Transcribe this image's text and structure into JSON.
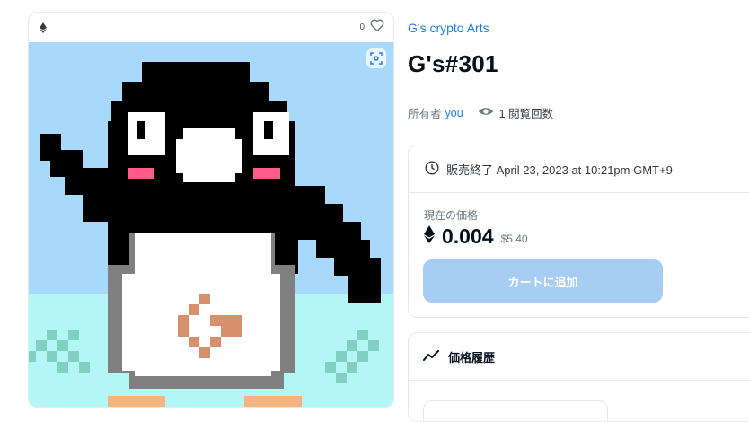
{
  "item": {
    "collection": "G's crypto Arts",
    "title": "G's#301",
    "owner_label": "所有者",
    "owner_name": "you",
    "views_text": "1 閲覧回数",
    "favorites_count": "0"
  },
  "sale": {
    "end_text": "販売終了 April 23, 2023 at 10:21pm GMT+9",
    "price_label": "現在の価格",
    "price_eth": "0.004",
    "price_usd": "$5.40",
    "cart_button": "カートに追加"
  },
  "history": {
    "title": "価格履歴"
  },
  "icons": {
    "chain": "ethereum-icon",
    "favorite": "heart-icon",
    "views": "eye-icon",
    "clock": "clock-icon",
    "history": "trend-icon",
    "zoom": "scan-icon"
  },
  "colors": {
    "accent": "#2081e2",
    "cart_button": "#a7cdf2",
    "art_sky": "#a8d9fb",
    "art_ground": "#b4f6f5"
  }
}
